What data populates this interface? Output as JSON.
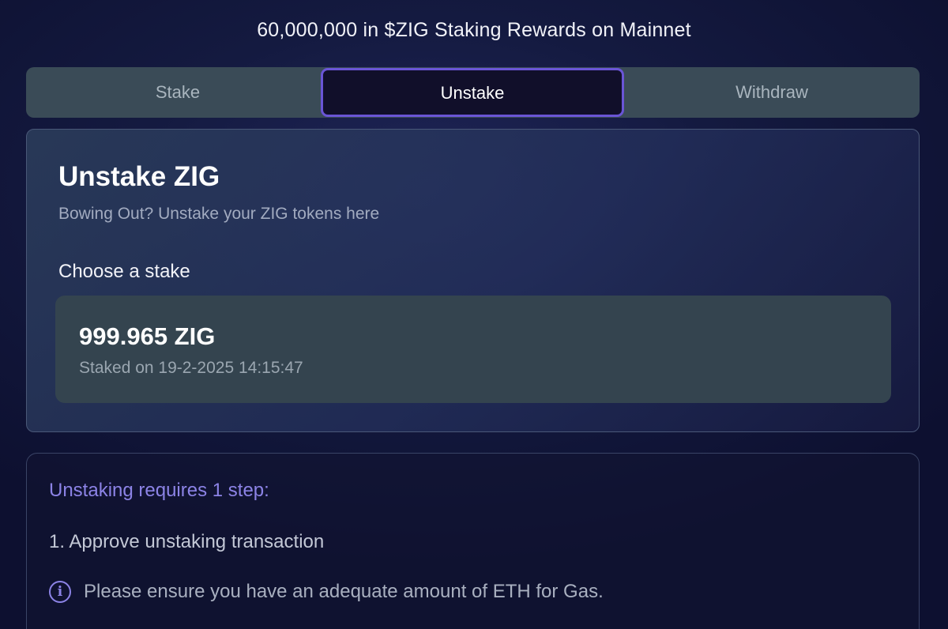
{
  "banner": "60,000,000 in $ZIG Staking Rewards on Mainnet",
  "tabs": [
    {
      "label": "Stake",
      "active": false
    },
    {
      "label": "Unstake",
      "active": true
    },
    {
      "label": "Withdraw",
      "active": false
    }
  ],
  "card": {
    "title": "Unstake ZIG",
    "subtitle": "Bowing Out? Unstake your ZIG tokens here",
    "choose_label": "Choose a stake",
    "stakes": [
      {
        "amount": "999.965 ZIG",
        "date": "Staked on 19-2-2025 14:15:47"
      }
    ]
  },
  "info": {
    "requirement": "Unstaking requires 1 step:",
    "steps": [
      "1. Approve unstaking transaction"
    ],
    "note_icon": "info-icon",
    "note": "Please ensure you have an adequate amount of ETH for Gas."
  },
  "colors": {
    "accent": "#6a55d6",
    "accent_text": "#8c83e6",
    "tab_bg": "#3a4b57",
    "active_tab_bg": "#110f2a",
    "stake_item_bg": "#34444f"
  }
}
